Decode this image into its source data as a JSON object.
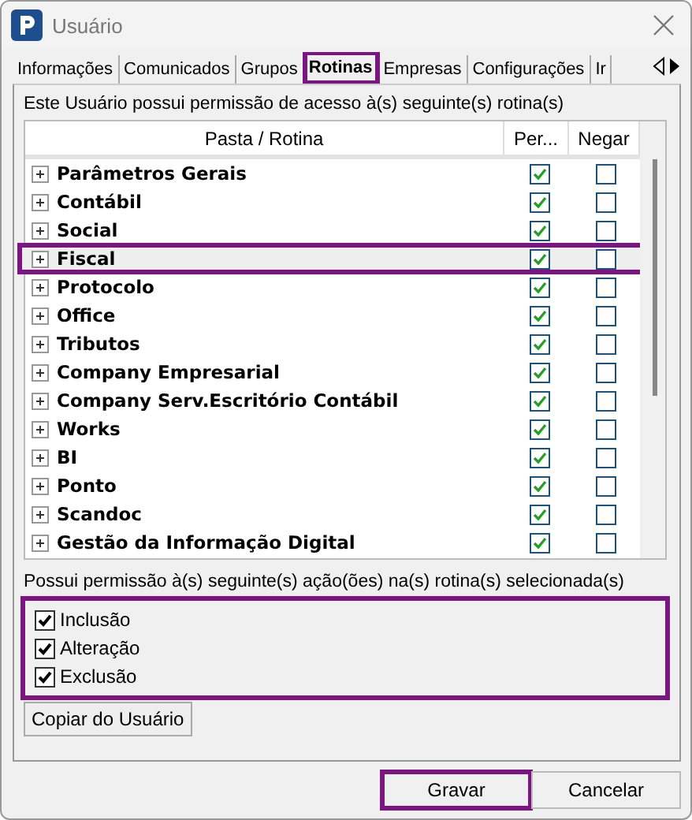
{
  "window": {
    "title": "Usuário"
  },
  "tabs": [
    {
      "label": "Informações",
      "selected": false,
      "highlighted": false
    },
    {
      "label": "Comunicados",
      "selected": false,
      "highlighted": false
    },
    {
      "label": "Grupos",
      "selected": false,
      "highlighted": false
    },
    {
      "label": "Rotinas",
      "selected": true,
      "highlighted": true
    },
    {
      "label": "Empresas",
      "selected": false,
      "highlighted": false
    },
    {
      "label": "Configurações",
      "selected": false,
      "highlighted": false
    },
    {
      "label": "Ir",
      "selected": false,
      "highlighted": false
    }
  ],
  "routines_label": "Este Usuário possui permissão de acesso à(s) seguinte(s) rotina(s)",
  "table": {
    "columns": [
      "Pasta / Rotina",
      "Per...",
      "Negar"
    ],
    "rows": [
      {
        "name": "Parâmetros Gerais",
        "expanded": false,
        "allow": true,
        "deny": false,
        "selected": false,
        "highlighted": false
      },
      {
        "name": "Contábil",
        "expanded": false,
        "allow": true,
        "deny": false,
        "selected": false,
        "highlighted": false
      },
      {
        "name": "Social",
        "expanded": false,
        "allow": true,
        "deny": false,
        "selected": false,
        "highlighted": false
      },
      {
        "name": "Fiscal",
        "expanded": false,
        "allow": true,
        "deny": false,
        "selected": true,
        "highlighted": true
      },
      {
        "name": "Protocolo",
        "expanded": false,
        "allow": true,
        "deny": false,
        "selected": false,
        "highlighted": false
      },
      {
        "name": "Office",
        "expanded": false,
        "allow": true,
        "deny": false,
        "selected": false,
        "highlighted": false
      },
      {
        "name": "Tributos",
        "expanded": false,
        "allow": true,
        "deny": false,
        "selected": false,
        "highlighted": false
      },
      {
        "name": "Company Empresarial",
        "expanded": false,
        "allow": true,
        "deny": false,
        "selected": false,
        "highlighted": false
      },
      {
        "name": "Company Serv.Escritório Contábil",
        "expanded": false,
        "allow": true,
        "deny": false,
        "selected": false,
        "highlighted": false
      },
      {
        "name": "Works",
        "expanded": false,
        "allow": true,
        "deny": false,
        "selected": false,
        "highlighted": false
      },
      {
        "name": "BI",
        "expanded": false,
        "allow": true,
        "deny": false,
        "selected": false,
        "highlighted": false
      },
      {
        "name": "Ponto",
        "expanded": false,
        "allow": true,
        "deny": false,
        "selected": false,
        "highlighted": false
      },
      {
        "name": "Scandoc",
        "expanded": false,
        "allow": true,
        "deny": false,
        "selected": false,
        "highlighted": false
      },
      {
        "name": "Gestão da Informação Digital",
        "expanded": false,
        "allow": true,
        "deny": false,
        "selected": false,
        "highlighted": false
      }
    ]
  },
  "actions_label": "Possui permissão à(s) seguinte(s) ação(ões) na(s) rotina(s) selecionada(s)",
  "actions": {
    "highlighted": true,
    "items": [
      {
        "label": "Inclusão",
        "checked": true
      },
      {
        "label": "Alteração",
        "checked": true
      },
      {
        "label": "Exclusão",
        "checked": true
      }
    ]
  },
  "copy_button": "Copiar do Usuário",
  "buttons": [
    {
      "label": "Gravar",
      "highlighted": true
    },
    {
      "label": "Cancelar",
      "highlighted": false
    }
  ]
}
